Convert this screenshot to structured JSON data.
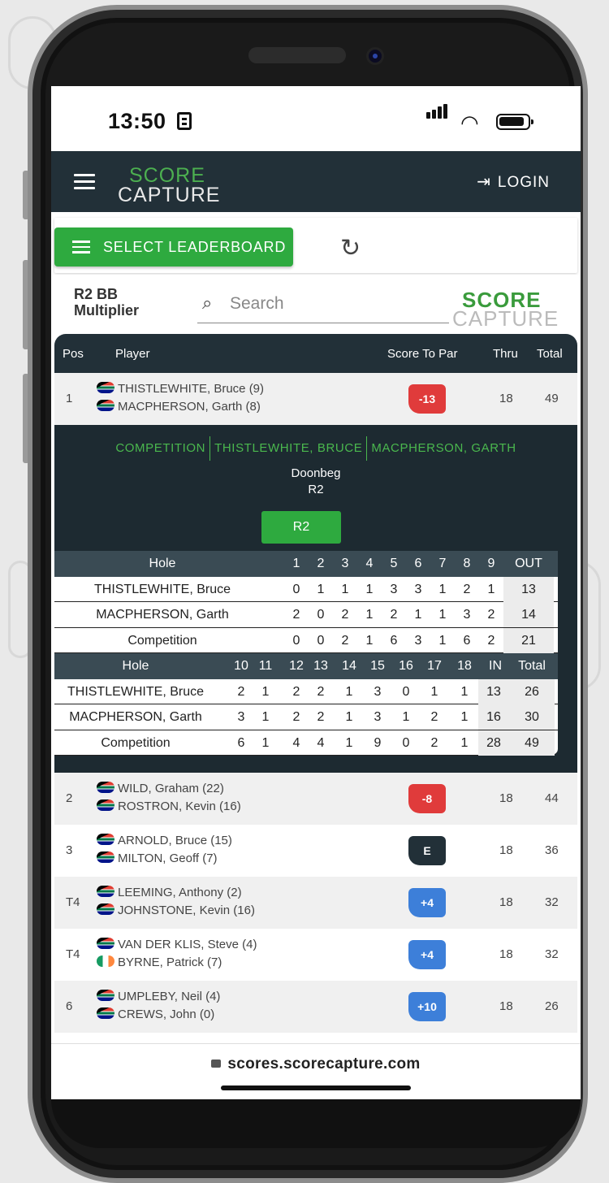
{
  "status": {
    "time": "13:50"
  },
  "nav": {
    "logo_top": "SCORE",
    "logo_bottom": "CAPTURE",
    "login_label": "LOGIN"
  },
  "toolbar": {
    "select_label": "SELECT LEADERBOARD"
  },
  "leaderboard": {
    "name": "R2 BB Multiplier",
    "search_placeholder": "Search",
    "logo_top": "SCORE",
    "logo_bottom": "CAPTURE",
    "columns": {
      "pos": "Pos",
      "player": "Player",
      "score": "Score To Par",
      "thru": "Thru",
      "total": "Total"
    },
    "rows": [
      {
        "pos": "1",
        "p1": "THISTLEWHITE, Bruce (9)",
        "p2": "MACPHERSON, Garth (8)",
        "score": "-13",
        "score_color": "#e03b3b",
        "thru": "18",
        "total": "49"
      },
      {
        "pos": "2",
        "p1": "WILD, Graham (22)",
        "p2": "ROSTRON, Kevin (16)",
        "score": "-8",
        "score_color": "#e03b3b",
        "thru": "18",
        "total": "44"
      },
      {
        "pos": "3",
        "p1": "ARNOLD, Bruce (15)",
        "p2": "MILTON, Geoff (7)",
        "score": "E",
        "score_color": "#223038",
        "thru": "18",
        "total": "36"
      },
      {
        "pos": "T4",
        "p1": "LEEMING, Anthony (2)",
        "p2": "JOHNSTONE, Kevin (16)",
        "score": "+4",
        "score_color": "#3d7fd9",
        "thru": "18",
        "total": "32"
      },
      {
        "pos": "T4",
        "p1": "VAN DER KLIS, Steve (4)",
        "p2": "BYRNE, Patrick (7)",
        "score": "+4",
        "score_color": "#3d7fd9",
        "thru": "18",
        "total": "32"
      },
      {
        "pos": "6",
        "p1": "UMPLEBY, Neil (4)",
        "p2": "CREWS, John (0)",
        "score": "+10",
        "score_color": "#3d7fd9",
        "thru": "18",
        "total": "26"
      }
    ]
  },
  "detail": {
    "tabs": [
      "COMPETITION",
      "THISTLEWHITE, BRUCE",
      "MACPHERSON, GARTH"
    ],
    "course": "Doonbeg",
    "round": "R2",
    "round_button": "R2",
    "front": {
      "hole_label": "Hole",
      "holes": [
        "1",
        "2",
        "3",
        "4",
        "5",
        "6",
        "7",
        "8",
        "9"
      ],
      "total_label": "OUT",
      "rows": [
        {
          "name": "THISTLEWHITE, Bruce",
          "scores": [
            "0",
            "1",
            "1",
            "1",
            "3",
            "3",
            "1",
            "2",
            "1"
          ],
          "total": "13"
        },
        {
          "name": "MACPHERSON, Garth",
          "scores": [
            "2",
            "0",
            "2",
            "1",
            "2",
            "1",
            "1",
            "3",
            "2"
          ],
          "total": "14"
        },
        {
          "name": "Competition",
          "scores": [
            "0",
            "0",
            "2",
            "1",
            "6",
            "3",
            "1",
            "6",
            "2"
          ],
          "total": "21"
        }
      ]
    },
    "back": {
      "hole_label": "Hole",
      "holes": [
        "10",
        "11",
        "12",
        "13",
        "14",
        "15",
        "16",
        "17",
        "18"
      ],
      "in_label": "IN",
      "total_label": "Total",
      "rows": [
        {
          "name": "THISTLEWHITE, Bruce",
          "scores": [
            "2",
            "1",
            "2",
            "2",
            "1",
            "3",
            "0",
            "1",
            "1"
          ],
          "in": "13",
          "total": "26"
        },
        {
          "name": "MACPHERSON, Garth",
          "scores": [
            "3",
            "1",
            "2",
            "2",
            "1",
            "3",
            "1",
            "2",
            "1"
          ],
          "in": "16",
          "total": "30"
        },
        {
          "name": "Competition",
          "scores": [
            "6",
            "1",
            "4",
            "4",
            "1",
            "9",
            "0",
            "2",
            "1"
          ],
          "in": "28",
          "total": "49"
        }
      ]
    }
  },
  "url": {
    "domain": "scores.scorecapture.com"
  }
}
